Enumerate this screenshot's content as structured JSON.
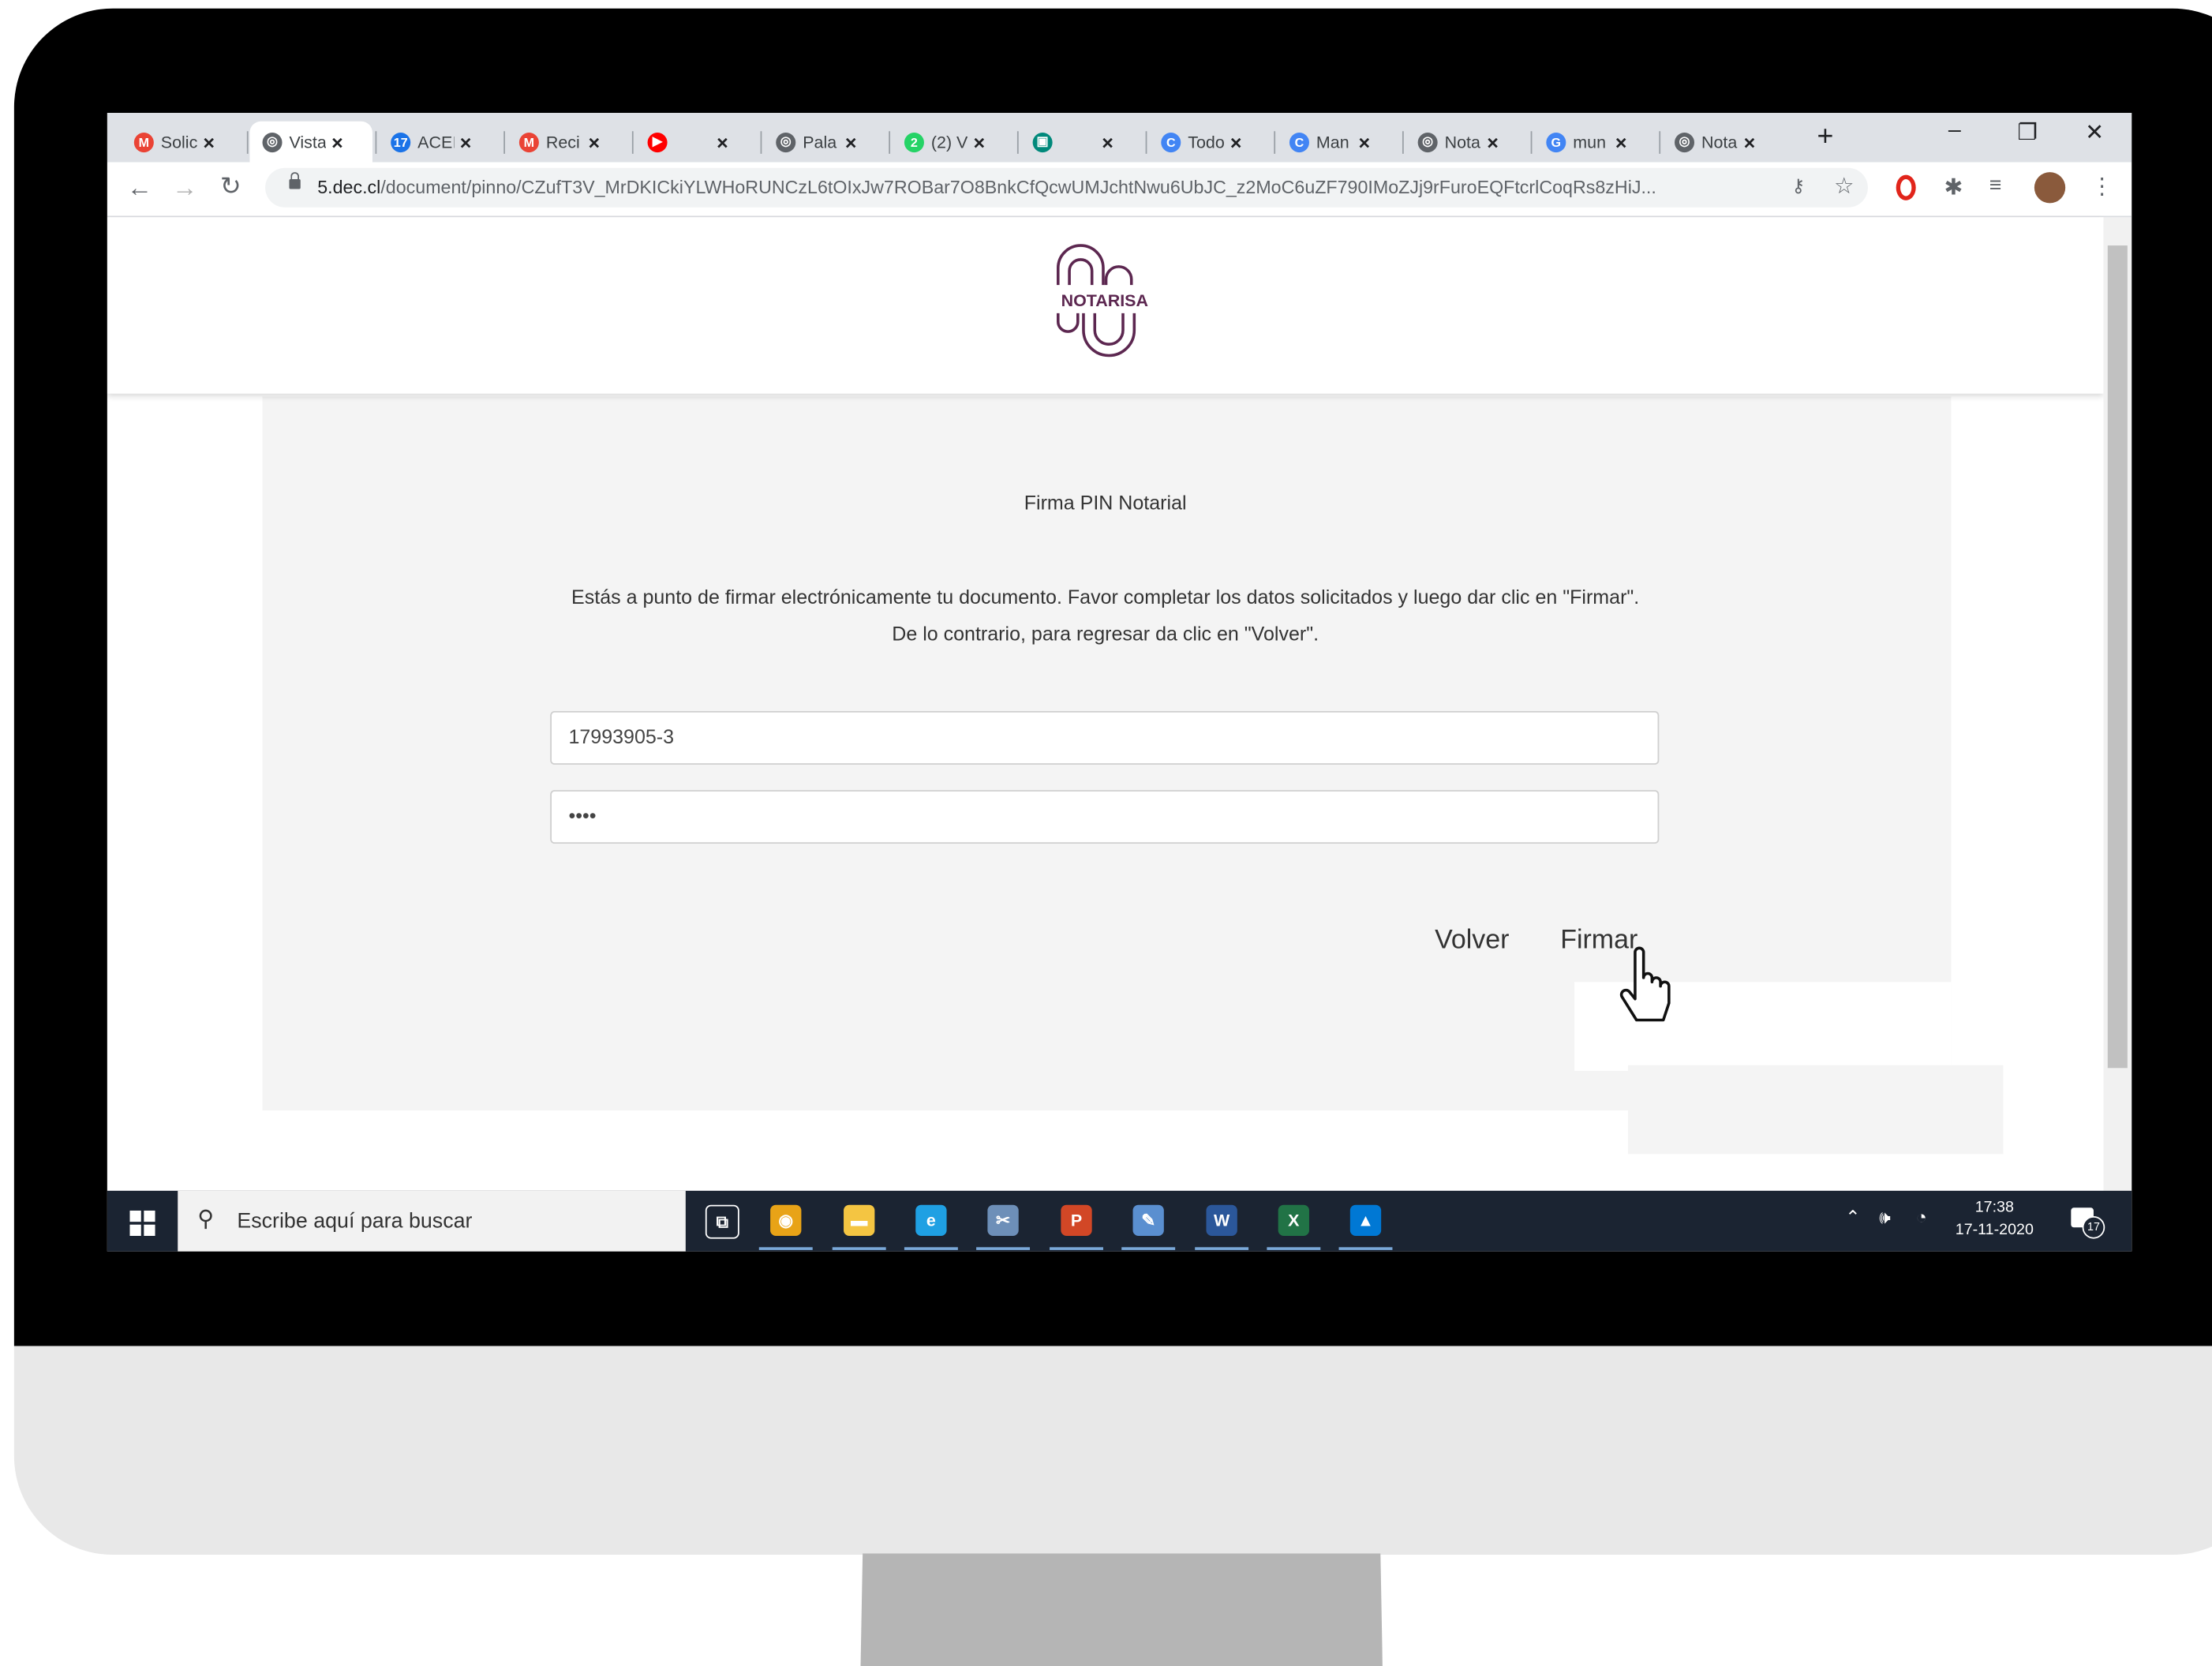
{
  "browser": {
    "tabs": [
      {
        "label": "Solic",
        "icon": "gmail-icon",
        "color": "#ea4335",
        "glyph": "M",
        "active": false
      },
      {
        "label": "Vista",
        "icon": "globe-icon",
        "color": "#5f6368",
        "glyph": "◎",
        "active": true
      },
      {
        "label": "ACEI",
        "icon": "calendar-icon",
        "color": "#1a73e8",
        "glyph": "17",
        "active": false
      },
      {
        "label": "Reci",
        "icon": "gmail-icon",
        "color": "#ea4335",
        "glyph": "M",
        "active": false
      },
      {
        "label": "",
        "icon": "youtube-icon",
        "color": "#ff0000",
        "glyph": "▶",
        "active": false
      },
      {
        "label": "Pala",
        "icon": "globe-icon",
        "color": "#5f6368",
        "glyph": "◎",
        "active": false
      },
      {
        "label": "(2) V",
        "icon": "whatsapp-icon",
        "color": "#25d366",
        "glyph": "2",
        "active": false
      },
      {
        "label": "",
        "icon": "meet-icon",
        "color": "#00897b",
        "glyph": "▣",
        "active": false
      },
      {
        "label": "Todo",
        "icon": "app-icon",
        "color": "#4285f4",
        "glyph": "C",
        "active": false
      },
      {
        "label": "Man",
        "icon": "app-icon",
        "color": "#4285f4",
        "glyph": "C",
        "active": false
      },
      {
        "label": "Nota",
        "icon": "globe-icon",
        "color": "#5f6368",
        "glyph": "◎",
        "active": false
      },
      {
        "label": "mun",
        "icon": "google-icon",
        "color": "#4285f4",
        "glyph": "G",
        "active": false
      },
      {
        "label": "Nota",
        "icon": "globe-icon",
        "color": "#5f6368",
        "glyph": "◎",
        "active": false
      }
    ],
    "new_tab": "+",
    "url_domain": "5.dec.cl",
    "url_path": "/document/pinno/CZufT3V_MrDKICkiYLWHoRUNCzL6tOIxJw7ROBar7O8BnkCfQcwUMJchtNwu6UbJC_z2MoC6uZF790IMoZJj9rFuroEQFtcrlCoqRs8zHiJ...",
    "window_controls": {
      "minimize": "–",
      "maximize": "❐",
      "close": "✕"
    }
  },
  "site": {
    "logo_text": "NOTARISA",
    "brand_color": "#5c2750",
    "form_title": "Firma PIN Notarial",
    "message_line1": "Estás a punto de firmar electrónicamente tu documento. Favor completar los datos solicitados y luego dar clic en \"Firmar\".",
    "message_line2": "De lo contrario, para regresar da clic en \"Volver\".",
    "rut_value": "17993905-3",
    "pin_value": "••••",
    "back_label": "Volver",
    "sign_label": "Firmar"
  },
  "taskbar": {
    "search_placeholder": "Escribe aquí para buscar",
    "time": "17:38",
    "date": "17-11-2020",
    "notification_count": "17",
    "apps": [
      {
        "icon": "task-view-icon",
        "color": "#1b2432",
        "glyph": "⧉"
      },
      {
        "icon": "chrome-icon",
        "color": "#e8a317",
        "glyph": "◉"
      },
      {
        "icon": "file-explorer-icon",
        "color": "#f4c542",
        "glyph": "▬"
      },
      {
        "icon": "edge-icon",
        "color": "#1fa0e3",
        "glyph": "e"
      },
      {
        "icon": "snipping-icon",
        "color": "#6d8fb8",
        "glyph": "✂"
      },
      {
        "icon": "powerpoint-icon",
        "color": "#d24726",
        "glyph": "P"
      },
      {
        "icon": "paint-icon",
        "color": "#5a8fd0",
        "glyph": "✎"
      },
      {
        "icon": "word-icon",
        "color": "#2b579a",
        "glyph": "W"
      },
      {
        "icon": "excel-icon",
        "color": "#217346",
        "glyph": "X"
      },
      {
        "icon": "photos-icon",
        "color": "#0078d4",
        "glyph": "▲"
      }
    ]
  }
}
